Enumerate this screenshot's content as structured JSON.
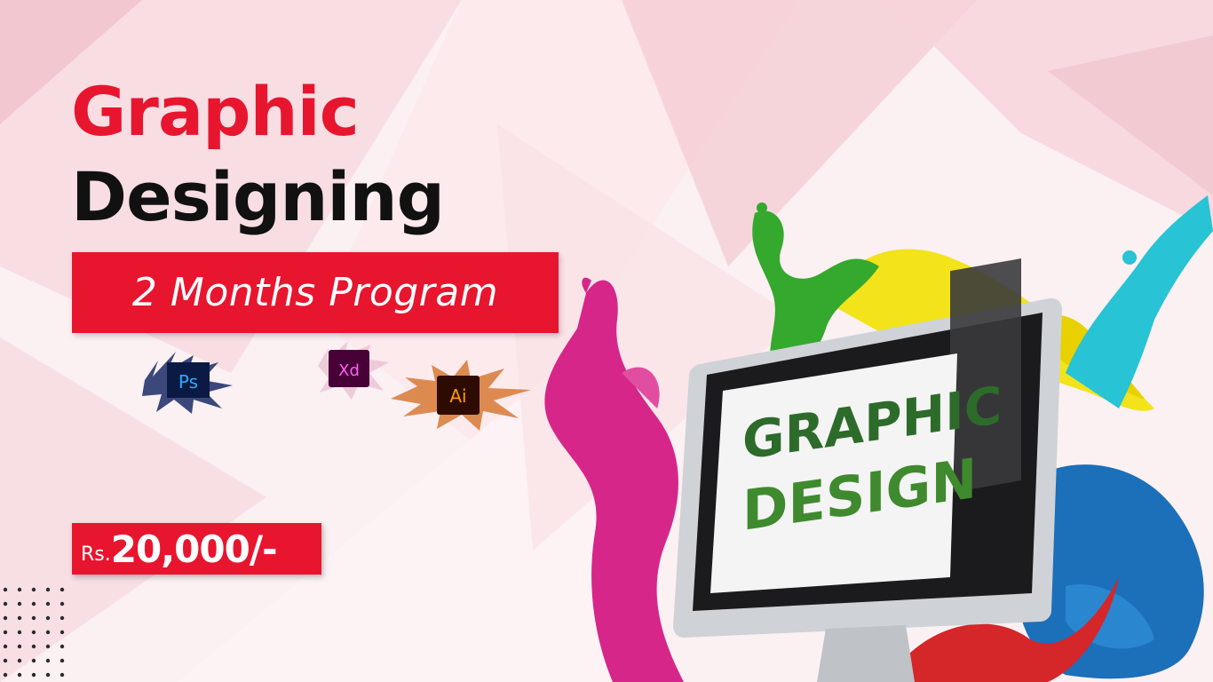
{
  "headline": {
    "line1": "Graphic",
    "line2": "Designing"
  },
  "program_label": "2 Months Program",
  "price": {
    "prefix": "Rs.",
    "amount": "20,000/-"
  },
  "software_icons": [
    {
      "name": "photoshop-icon",
      "text": "Ps"
    },
    {
      "name": "adobe-xd-icon",
      "text": "Xd"
    },
    {
      "name": "illustrator-icon",
      "text": "Ai"
    }
  ],
  "monitor_screen": {
    "line1": "GRAPHIC",
    "line2": "DESIGN"
  },
  "colors": {
    "accent_red": "#e8152f",
    "headline_dark": "#111111",
    "background": "#fbeff1"
  }
}
